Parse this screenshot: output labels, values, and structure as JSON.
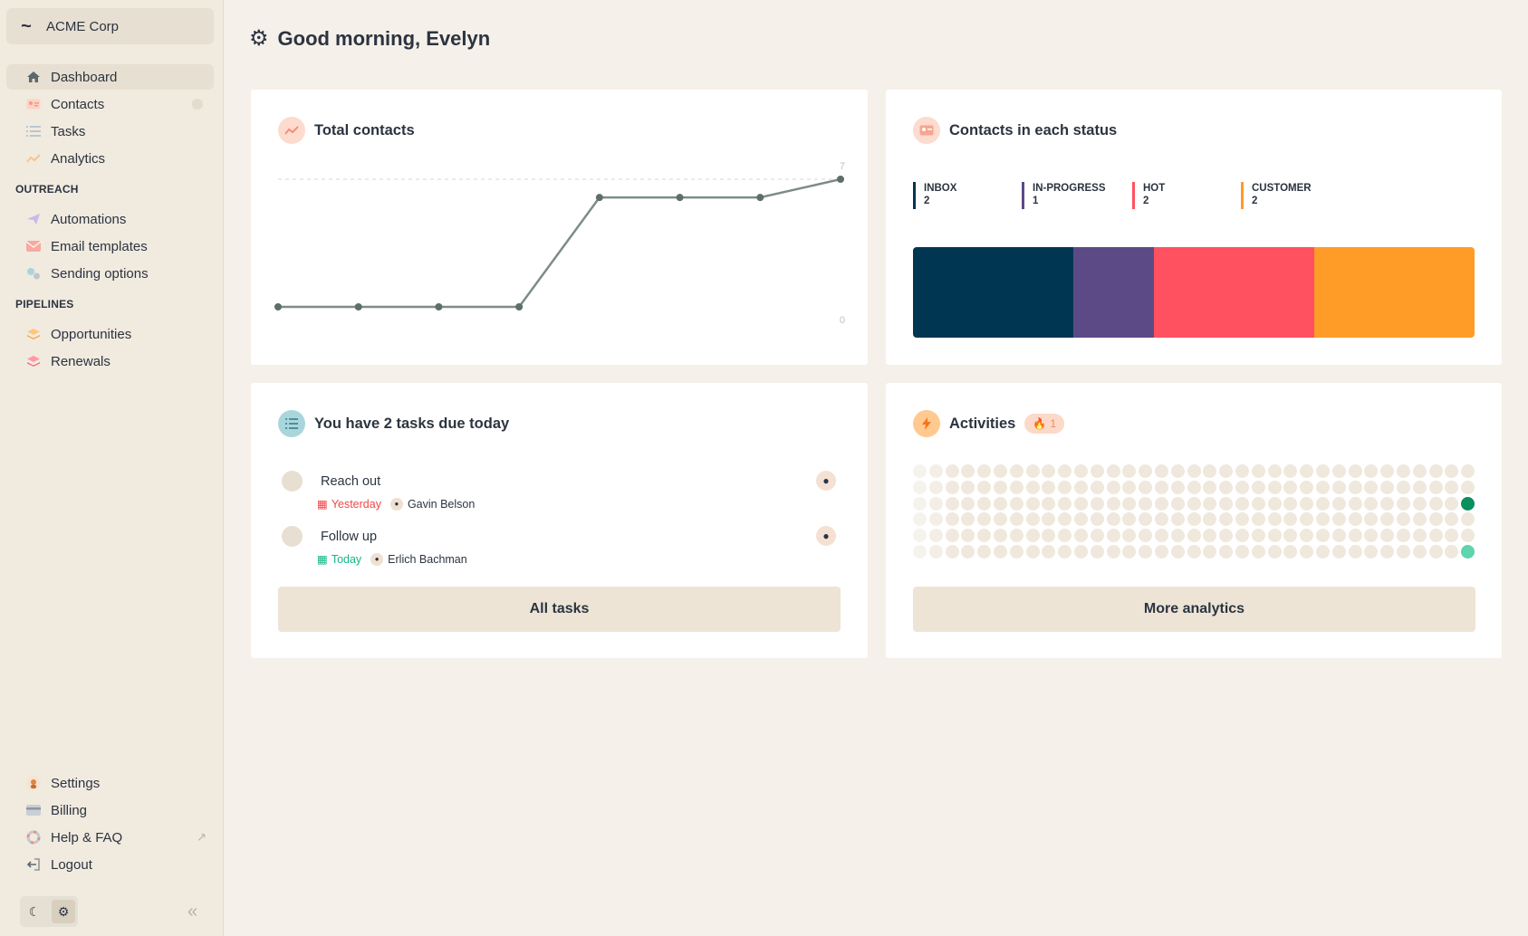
{
  "sidebar": {
    "org_name": "ACME Corp",
    "items": [
      {
        "label": "Dashboard",
        "icon": "home-icon"
      },
      {
        "label": "Contacts",
        "icon": "contact-card-icon"
      },
      {
        "label": "Tasks",
        "icon": "list-icon"
      },
      {
        "label": "Analytics",
        "icon": "chart-icon"
      }
    ],
    "outreach_title": "OUTREACH",
    "outreach": [
      {
        "label": "Automations",
        "icon": "paper-plane-icon"
      },
      {
        "label": "Email templates",
        "icon": "envelope-icon"
      },
      {
        "label": "Sending options",
        "icon": "gears-icon"
      }
    ],
    "pipelines_title": "PIPELINES",
    "pipelines": [
      {
        "label": "Opportunities",
        "icon": "stack-icon"
      },
      {
        "label": "Renewals",
        "icon": "stack-icon"
      }
    ],
    "bottom": [
      {
        "label": "Settings",
        "icon": "settings-avatar-icon"
      },
      {
        "label": "Billing",
        "icon": "credit-card-icon"
      },
      {
        "label": "Help & FAQ",
        "icon": "lifebuoy-icon"
      },
      {
        "label": "Logout",
        "icon": "logout-icon"
      }
    ]
  },
  "header": {
    "greeting": "Good morning, Evelyn"
  },
  "total_contacts": {
    "title": "Total contacts",
    "chart_data": {
      "type": "line",
      "x": [
        1,
        2,
        3,
        4,
        5,
        6,
        7,
        8
      ],
      "values": [
        0,
        0,
        0,
        0,
        6,
        6,
        6,
        7
      ],
      "ylim": [
        0,
        7
      ],
      "y_ticks": [
        "7",
        "0"
      ]
    }
  },
  "status": {
    "title": "Contacts in each status",
    "items": [
      {
        "label": "INBOX",
        "count": "2",
        "value": 2,
        "color": "#003652"
      },
      {
        "label": "IN-PROGRESS",
        "count": "1",
        "value": 1,
        "color": "#5c4a86"
      },
      {
        "label": "HOT",
        "count": "2",
        "value": 2,
        "color": "#ff515f"
      },
      {
        "label": "CUSTOMER",
        "count": "2",
        "value": 2,
        "color": "#ff9c28"
      }
    ]
  },
  "tasks": {
    "title": "You have 2 tasks due today",
    "items": [
      {
        "title": "Reach out",
        "due": "Yesterday",
        "due_color": "#f04848",
        "assignee": "Gavin Belson"
      },
      {
        "title": "Follow up",
        "due": "Today",
        "due_color": "#17b58a",
        "assignee": "Erlich Bachman"
      }
    ],
    "button": "All tasks"
  },
  "activities": {
    "title": "Activities",
    "badge": "1",
    "button": "More analytics",
    "active_cells": [
      {
        "row": 2,
        "col": 34,
        "color": "#0a8f5f"
      },
      {
        "row": 5,
        "col": 34,
        "color": "#5fd4ad"
      }
    ]
  },
  "colors": {
    "accent": "#f08b5a",
    "line": "#7d8c89",
    "point": "#5e6e6a"
  }
}
